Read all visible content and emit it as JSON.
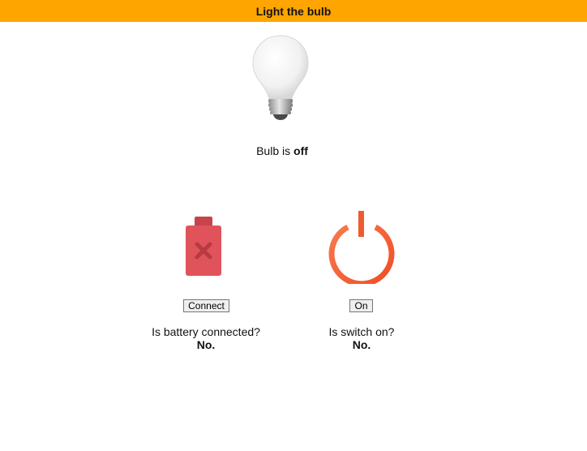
{
  "header": {
    "title": "Light the bulb"
  },
  "bulb": {
    "icon": "lightbulb-icon",
    "status_prefix": "Bulb is ",
    "status_value": "off"
  },
  "battery": {
    "icon": "battery-disconnected-icon",
    "button_label": "Connect",
    "question": "Is battery connected?",
    "answer": "No.",
    "color": "#e0535a"
  },
  "switch": {
    "icon": "power-icon",
    "button_label": "On",
    "question": "Is switch on?",
    "answer": "No.",
    "color": "#f4603a"
  },
  "colors": {
    "header_bg": "#ffa500"
  }
}
